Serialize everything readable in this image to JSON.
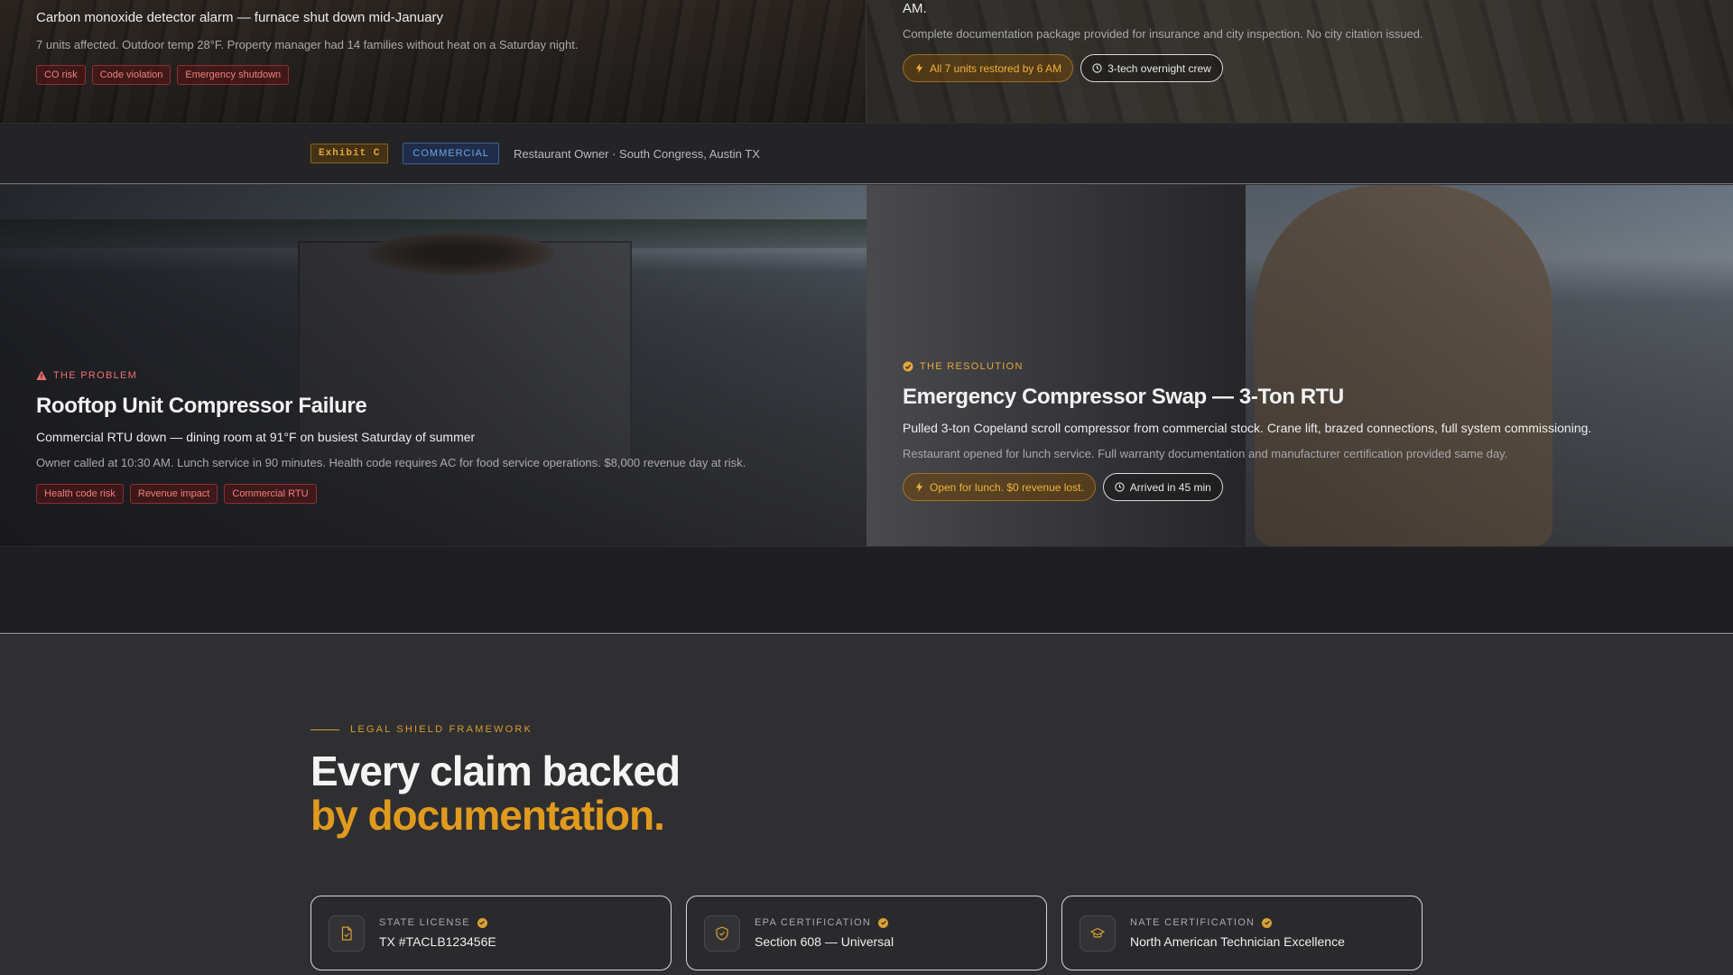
{
  "case_b": {
    "problem": {
      "headline": "Carbon monoxide detector alarm — furnace shut down mid-January",
      "detail": "7 units affected. Outdoor temp 28°F. Property manager had 14 families without heat on a Saturday night.",
      "tags": [
        "CO risk",
        "Code violation",
        "Emergency shutdown"
      ]
    },
    "resolution": {
      "headline_tail": "AM.",
      "detail": "Complete documentation package provided for insurance and city inspection. No city citation issued.",
      "outcome_pill": "All 7 units restored by 6 AM",
      "time_pill": "3-tech overnight crew"
    }
  },
  "exhibit_c": {
    "badge": "Exhibit C",
    "category": "COMMERCIAL",
    "client": "Restaurant Owner · South Congress, Austin TX",
    "problem": {
      "label": "THE PROBLEM",
      "title": "Rooftop Unit Compressor Failure",
      "headline": "Commercial RTU down — dining room at 91°F on busiest Saturday of summer",
      "detail": "Owner called at 10:30 AM. Lunch service in 90 minutes. Health code requires AC for food service operations. $8,000 revenue day at risk.",
      "tags": [
        "Health code risk",
        "Revenue impact",
        "Commercial RTU"
      ]
    },
    "resolution": {
      "label": "THE RESOLUTION",
      "title": "Emergency Compressor Swap — 3-Ton RTU",
      "headline": "Pulled 3-ton Copeland scroll compressor from commercial stock. Crane lift, brazed connections, full system commissioning.",
      "detail": "Restaurant opened for lunch service. Full warranty documentation and manufacturer certification provided same day.",
      "outcome_pill": "Open for lunch. $0 revenue lost.",
      "time_pill": "Arrived in 45 min"
    }
  },
  "legal": {
    "eyebrow": "LEGAL SHIELD FRAMEWORK",
    "title_line1": "Every claim backed",
    "title_line2": "by documentation.",
    "certs": [
      {
        "label": "STATE LICENSE",
        "value": "TX #TACLB123456E",
        "icon": "file-check-icon"
      },
      {
        "label": "EPA CERTIFICATION",
        "value": "Section 608 — Universal",
        "icon": "shield-check-icon"
      },
      {
        "label": "NATE CERTIFICATION",
        "value": "North American Technician Excellence",
        "icon": "graduation-cap-icon"
      }
    ]
  },
  "colors": {
    "accent_gold": "#e09a1e",
    "problem_red": "#ef7070",
    "commercial_blue": "#6fa4e8",
    "background": "#2f2f32"
  }
}
